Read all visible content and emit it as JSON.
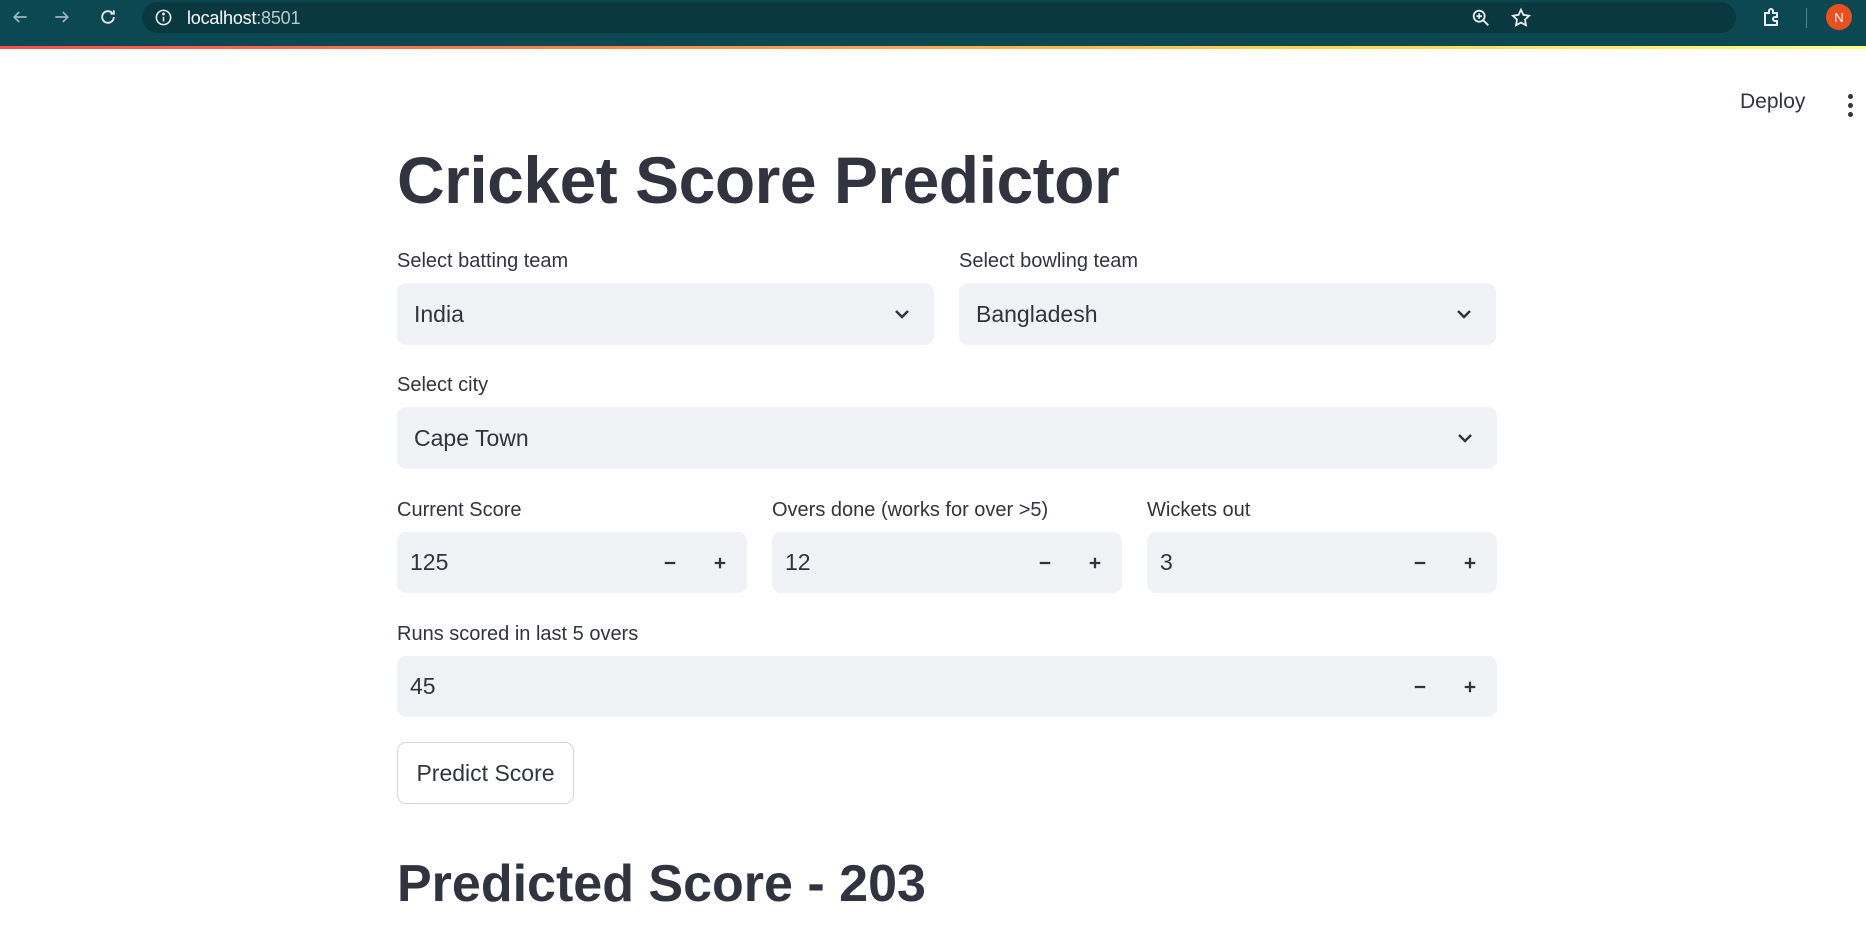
{
  "browser": {
    "url_host": "localhost",
    "url_port": ":8501",
    "profile_initial": "N"
  },
  "header": {
    "deploy_label": "Deploy"
  },
  "page": {
    "title": "Cricket Score Predictor"
  },
  "form": {
    "batting_team": {
      "label": "Select batting team",
      "value": "India"
    },
    "bowling_team": {
      "label": "Select bowling team",
      "value": "Bangladesh"
    },
    "city": {
      "label": "Select city",
      "value": "Cape Town"
    },
    "current_score": {
      "label": "Current Score",
      "value": "125"
    },
    "overs_done": {
      "label": "Overs done (works for over >5)",
      "value": "12"
    },
    "wickets_out": {
      "label": "Wickets out",
      "value": "3"
    },
    "runs_last_5": {
      "label": "Runs scored in last 5 overs",
      "value": "45"
    },
    "predict_button_label": "Predict Score"
  },
  "result": {
    "text": "Predicted Score - 203"
  },
  "colors": {
    "chrome_bg": "#0c4851",
    "widget_bg": "#f0f2f6",
    "text": "#31333f",
    "profile": "#e8501f"
  }
}
